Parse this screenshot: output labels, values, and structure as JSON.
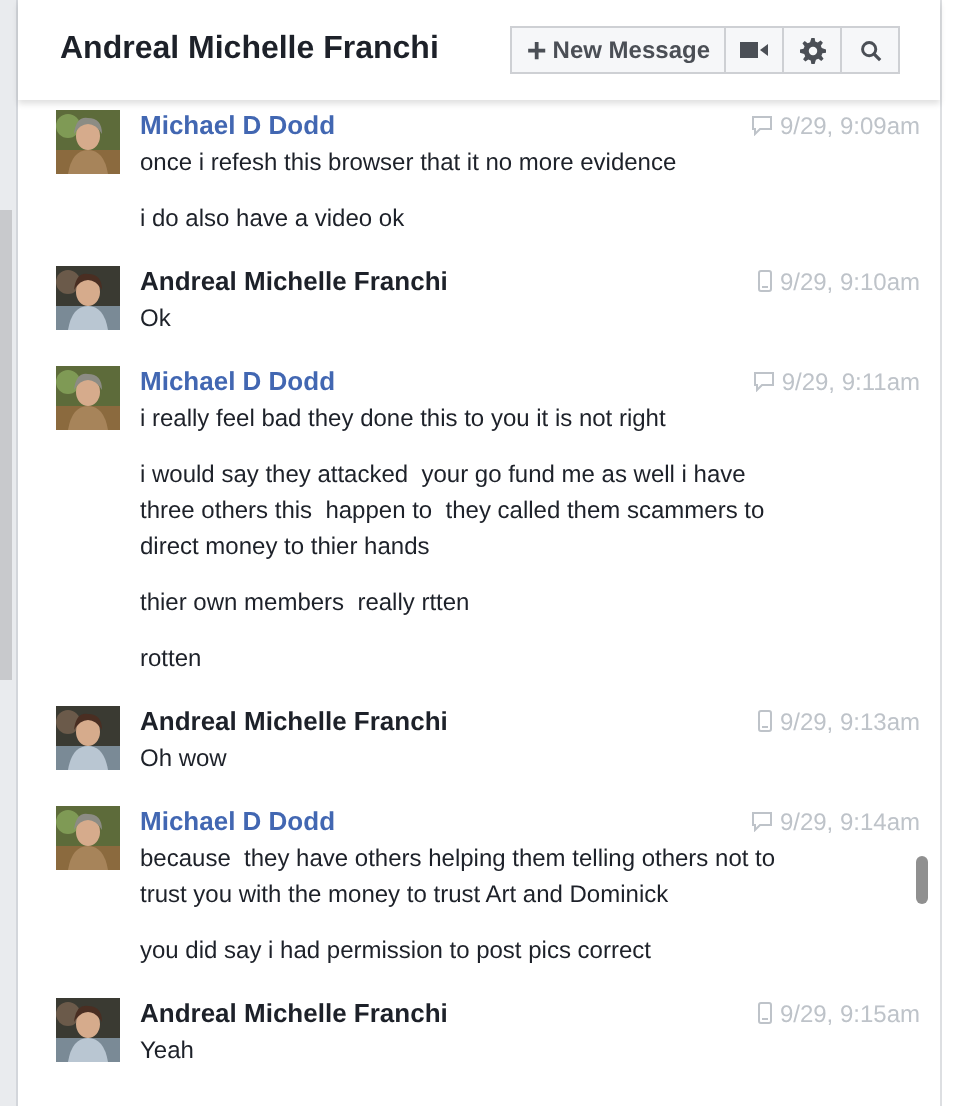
{
  "header": {
    "title": "Andreal Michelle Franchi",
    "new_message": {
      "icon": "+",
      "label": "New Message"
    }
  },
  "messages": [
    {
      "sender": "Michael D Dodd",
      "kind": "chat",
      "time": "9/29, 9:09am",
      "paragraphs": [
        "once i refesh this browser that it no more evidence",
        "i do also have a video ok"
      ]
    },
    {
      "sender": "Andreal Michelle Franchi",
      "kind": "mobile",
      "time": "9/29, 9:10am",
      "paragraphs": [
        "Ok"
      ]
    },
    {
      "sender": "Michael D Dodd",
      "kind": "chat",
      "time": "9/29, 9:11am",
      "paragraphs": [
        "i really feel bad they done this to you it is not right",
        "i would say they attacked  your go fund me as well i have three others this  happen to  they called them scammers to direct money to thier hands",
        "thier own members  really rtten",
        "rotten"
      ]
    },
    {
      "sender": "Andreal Michelle Franchi",
      "kind": "mobile",
      "time": "9/29, 9:13am",
      "paragraphs": [
        "Oh wow"
      ]
    },
    {
      "sender": "Michael D Dodd",
      "kind": "chat",
      "time": "9/29, 9:14am",
      "paragraphs": [
        "because  they have others helping them telling others not to trust you with the money to trust Art and Dominick",
        "you did say i had permission to post pics correct"
      ]
    },
    {
      "sender": "Andreal Michelle Franchi",
      "kind": "mobile",
      "time": "9/29, 9:15am",
      "paragraphs": [
        "Yeah"
      ]
    }
  ]
}
